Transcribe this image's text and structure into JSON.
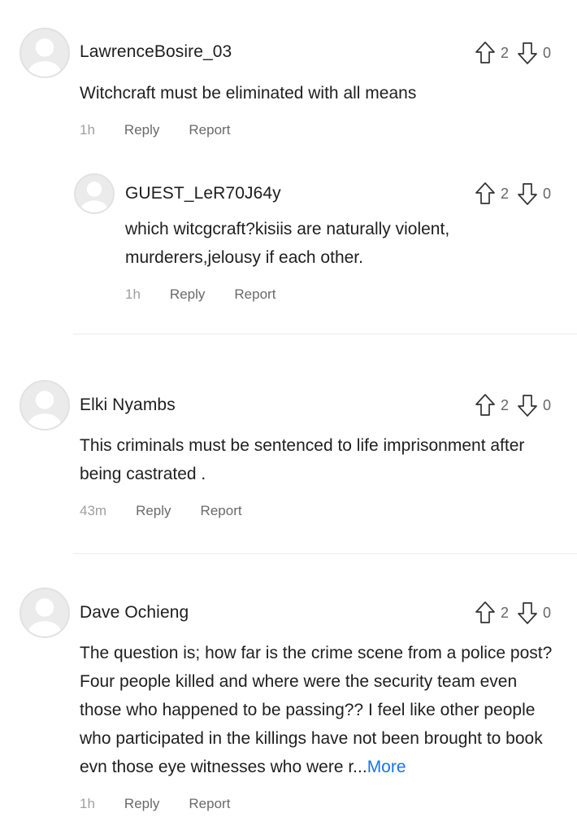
{
  "comments": [
    {
      "author": "LawrenceBosire_03",
      "up": "2",
      "down": "0",
      "text": "Witchcraft must be eliminated with all means",
      "time": "1h",
      "reply": "Reply",
      "report": "Report"
    },
    {
      "author": "GUEST_LeR70J64y",
      "up": "2",
      "down": "0",
      "text": "which witcgcraft?kisiis are naturally violent, murderers,jelousy if each other.",
      "time": "1h",
      "reply": "Reply",
      "report": "Report"
    },
    {
      "author": "Elki Nyambs",
      "up": "2",
      "down": "0",
      "text": "This criminals must be sentenced to life imprisonment after being castrated .",
      "time": "43m",
      "reply": "Reply",
      "report": "Report"
    },
    {
      "author": "Dave Ochieng",
      "up": "2",
      "down": "0",
      "text": "The question is; how far is the crime scene from a police post? Four people killed and where were the security team even those who happened to be passing?? I feel like other people who participated in the killings have not been brought to book evn those eye witnesses who were r...",
      "more": "More",
      "time": "1h",
      "reply": "Reply",
      "report": "Report"
    }
  ],
  "icons": {
    "upvote": "arrow-up-outline-icon",
    "downvote": "arrow-down-outline-icon",
    "avatar": "default-user-avatar"
  },
  "colors": {
    "link": "#1a73e8",
    "meta": "#a0a0a0",
    "divider": "#ececec"
  }
}
